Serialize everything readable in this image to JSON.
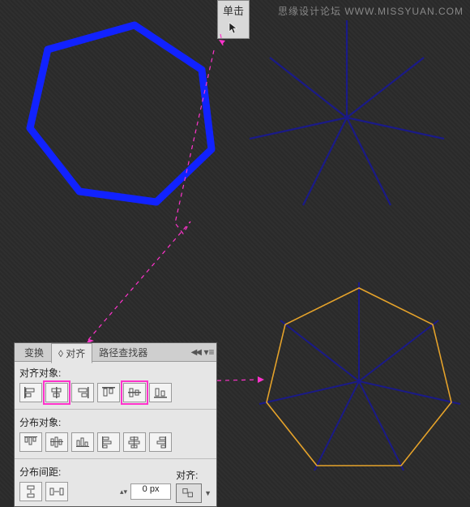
{
  "watermark": "思缘设计论坛 WWW.MISSYUAN.COM",
  "tooltip": {
    "label": "单击"
  },
  "panel": {
    "tabs": [
      {
        "label": "变换"
      },
      {
        "label": "◊ 对齐"
      },
      {
        "label": "路径查找器"
      }
    ],
    "active_tab": 1,
    "sections": {
      "align_objects": "对齐对象:",
      "distribute_objects": "分布对象:",
      "distribute_spacing": "分布间距:",
      "align_to": "对齐:"
    },
    "spacing_value": "0 px",
    "align_buttons": [
      "align-left",
      "align-hcenter",
      "align-right",
      "align-top",
      "align-vcenter",
      "align-bottom"
    ],
    "dist_buttons": [
      "dist-top",
      "dist-vcenter",
      "dist-bottom",
      "dist-left",
      "dist-hcenter",
      "dist-right"
    ],
    "spacing_buttons": [
      "dist-v-space",
      "dist-h-space"
    ]
  },
  "shapes": {
    "heptagon_stroke": "#1122ff",
    "star_stroke": "#1a1a88",
    "orange": "#e6a23c"
  }
}
